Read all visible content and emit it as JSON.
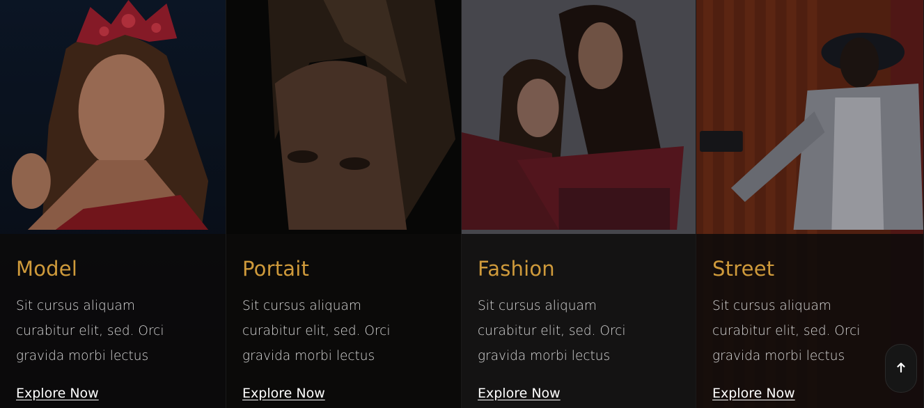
{
  "cards": [
    {
      "title": "Model",
      "description": "Sit cursus aliquam curabitur elit, sed. Orci gravida morbi lectus",
      "link": "Explore Now"
    },
    {
      "title": "Portait",
      "description": "Sit cursus aliquam curabitur elit, sed. Orci gravida morbi lectus",
      "link": "Explore Now"
    },
    {
      "title": "Fashion",
      "description": "Sit cursus aliquam curabitur elit, sed. Orci gravida morbi lectus",
      "link": "Explore Now"
    },
    {
      "title": "Street",
      "description": "Sit cursus aliquam curabitur elit, sed. Orci gravida morbi lectus",
      "link": "Explore Now"
    }
  ],
  "back_to_top": {
    "icon": "arrow-up-icon"
  },
  "colors": {
    "accent": "#cf9a3b",
    "overlay": "#0c0a0a",
    "text": "#d9d9d9",
    "link": "#ffffff"
  }
}
